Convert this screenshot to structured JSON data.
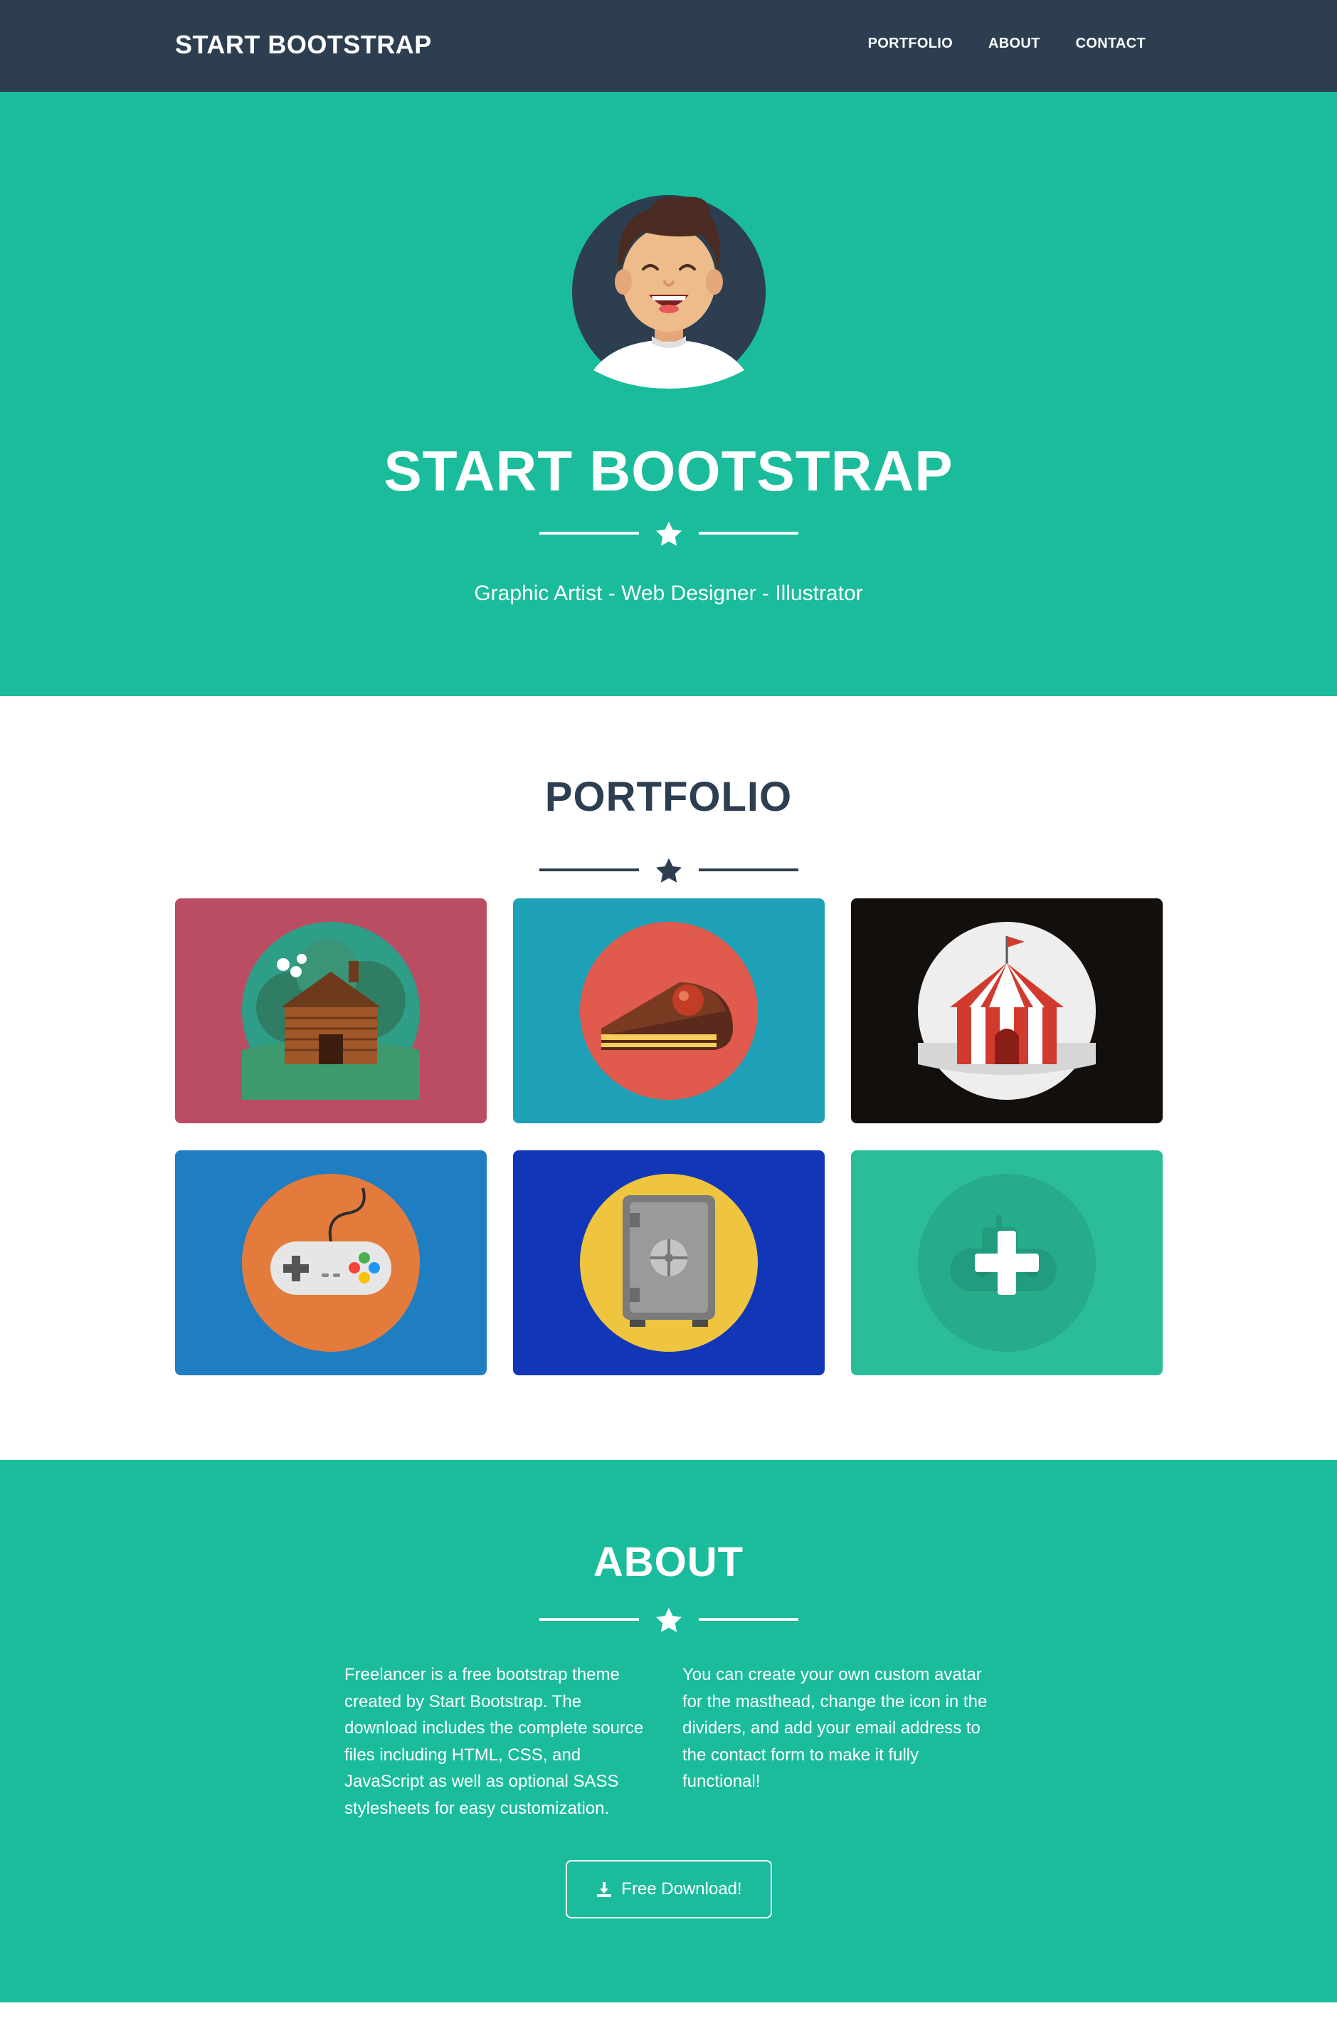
{
  "navbar": {
    "brand": "START BOOTSTRAP",
    "links": [
      "PORTFOLIO",
      "ABOUT",
      "CONTACT"
    ]
  },
  "masthead": {
    "title": "START BOOTSTRAP",
    "subtitle": "Graphic Artist - Web Designer - Illustrator"
  },
  "portfolio": {
    "title": "PORTFOLIO",
    "items": [
      {
        "icon": "cabin-icon",
        "bg": "#bb4d63"
      },
      {
        "icon": "cake-icon",
        "bg": "#1ea0b6"
      },
      {
        "icon": "circus-tent-icon",
        "bg": "#130f0d"
      },
      {
        "icon": "game-controller-icon",
        "bg": "#1f7dc1"
      },
      {
        "icon": "safe-icon",
        "bg": "#1236b8"
      },
      {
        "icon": "submarine-icon",
        "bg": "#2bbd9a"
      }
    ]
  },
  "about": {
    "title": "ABOUT",
    "col_left": "Freelancer is a free bootstrap theme created by Start Bootstrap. The download includes the complete source files including HTML, CSS, and JavaScript as well as optional SASS stylesheets for easy customization.",
    "col_right": "You can create your own custom avatar for the masthead, change the icon in the dividers, and add your email address to the contact form to make it fully functional!",
    "button_label": "Free Download!"
  },
  "colors": {
    "primary": "#1abc9c",
    "secondary": "#2c3e50",
    "white": "#ffffff"
  }
}
